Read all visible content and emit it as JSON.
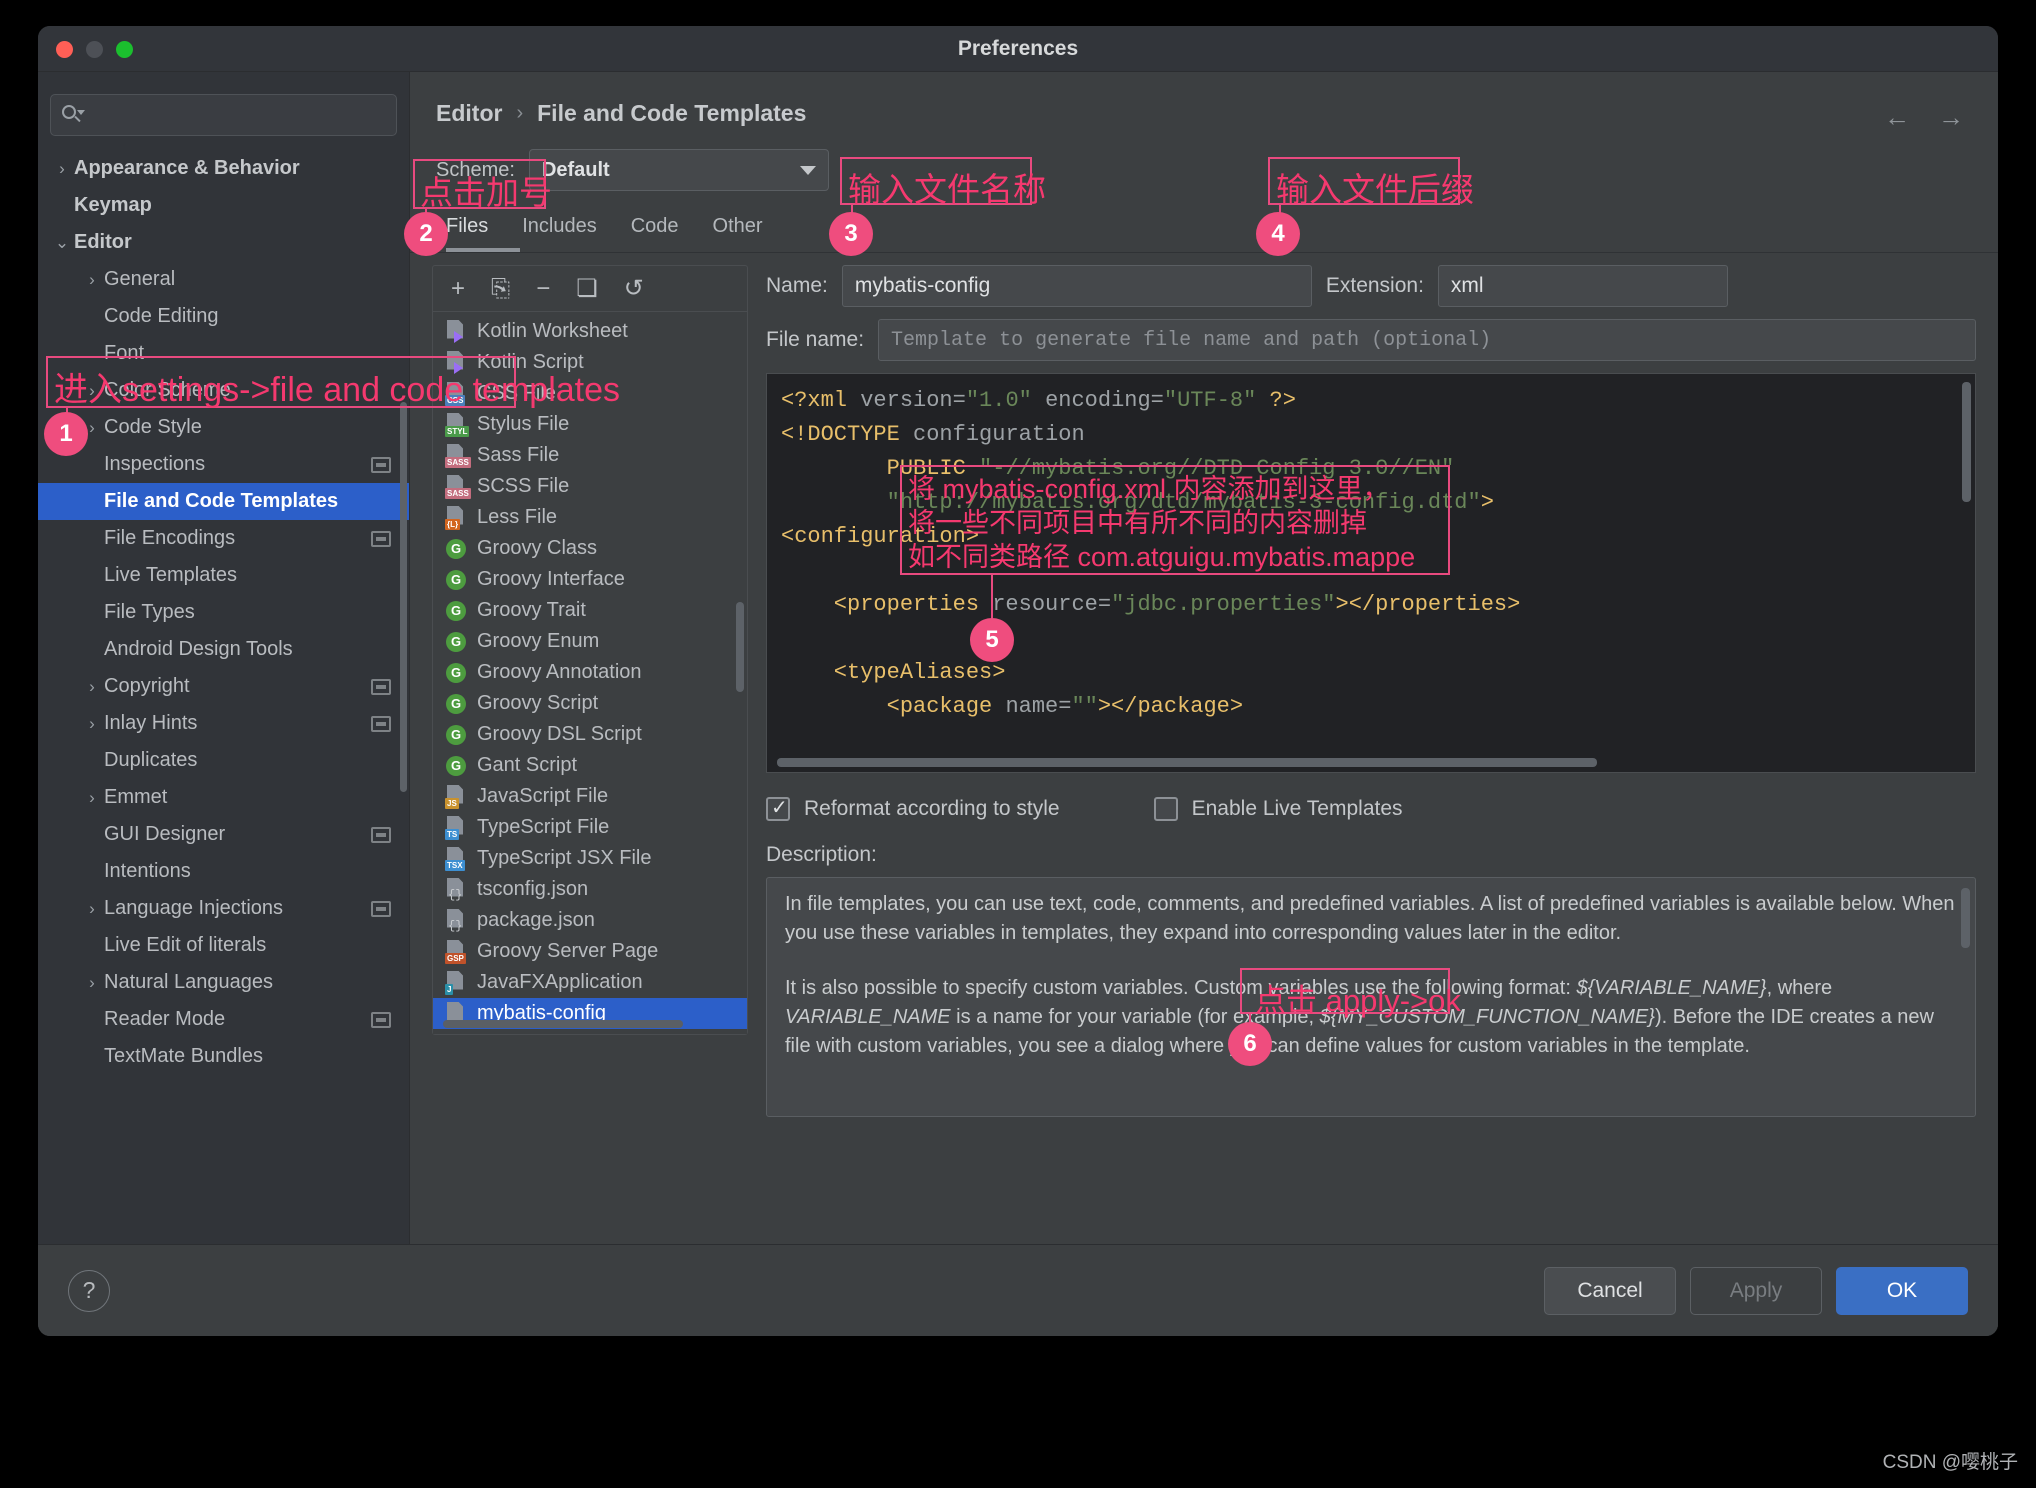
{
  "window": {
    "title": "Preferences"
  },
  "search": {
    "placeholder": ""
  },
  "sidebar": {
    "items": [
      {
        "label": "Appearance & Behavior",
        "chevron": "›",
        "bold": true,
        "indent": 0,
        "badge": false,
        "selected": false
      },
      {
        "label": "Keymap",
        "chevron": "",
        "bold": true,
        "indent": 0,
        "badge": false,
        "selected": false
      },
      {
        "label": "Editor",
        "chevron": "⌄",
        "bold": true,
        "indent": 0,
        "badge": false,
        "selected": false
      },
      {
        "label": "General",
        "chevron": "›",
        "bold": false,
        "indent": 1,
        "badge": false,
        "selected": false
      },
      {
        "label": "Code Editing",
        "chevron": "",
        "bold": false,
        "indent": 1,
        "badge": false,
        "selected": false
      },
      {
        "label": "Font",
        "chevron": "",
        "bold": false,
        "indent": 1,
        "badge": false,
        "selected": false
      },
      {
        "label": "Color Scheme",
        "chevron": "›",
        "bold": false,
        "indent": 1,
        "badge": false,
        "selected": false
      },
      {
        "label": "Code Style",
        "chevron": "›",
        "bold": false,
        "indent": 1,
        "badge": false,
        "selected": false
      },
      {
        "label": "Inspections",
        "chevron": "",
        "bold": false,
        "indent": 1,
        "badge": true,
        "selected": false
      },
      {
        "label": "File and Code Templates",
        "chevron": "",
        "bold": false,
        "indent": 1,
        "badge": false,
        "selected": true
      },
      {
        "label": "File Encodings",
        "chevron": "",
        "bold": false,
        "indent": 1,
        "badge": true,
        "selected": false
      },
      {
        "label": "Live Templates",
        "chevron": "",
        "bold": false,
        "indent": 1,
        "badge": false,
        "selected": false
      },
      {
        "label": "File Types",
        "chevron": "",
        "bold": false,
        "indent": 1,
        "badge": false,
        "selected": false
      },
      {
        "label": "Android Design Tools",
        "chevron": "",
        "bold": false,
        "indent": 1,
        "badge": false,
        "selected": false
      },
      {
        "label": "Copyright",
        "chevron": "›",
        "bold": false,
        "indent": 1,
        "badge": true,
        "selected": false
      },
      {
        "label": "Inlay Hints",
        "chevron": "›",
        "bold": false,
        "indent": 1,
        "badge": true,
        "selected": false
      },
      {
        "label": "Duplicates",
        "chevron": "",
        "bold": false,
        "indent": 1,
        "badge": false,
        "selected": false
      },
      {
        "label": "Emmet",
        "chevron": "›",
        "bold": false,
        "indent": 1,
        "badge": false,
        "selected": false
      },
      {
        "label": "GUI Designer",
        "chevron": "",
        "bold": false,
        "indent": 1,
        "badge": true,
        "selected": false
      },
      {
        "label": "Intentions",
        "chevron": "",
        "bold": false,
        "indent": 1,
        "badge": false,
        "selected": false
      },
      {
        "label": "Language Injections",
        "chevron": "›",
        "bold": false,
        "indent": 1,
        "badge": true,
        "selected": false
      },
      {
        "label": "Live Edit of literals",
        "chevron": "",
        "bold": false,
        "indent": 1,
        "badge": false,
        "selected": false
      },
      {
        "label": "Natural Languages",
        "chevron": "›",
        "bold": false,
        "indent": 1,
        "badge": false,
        "selected": false
      },
      {
        "label": "Reader Mode",
        "chevron": "",
        "bold": false,
        "indent": 1,
        "badge": true,
        "selected": false
      },
      {
        "label": "TextMate Bundles",
        "chevron": "",
        "bold": false,
        "indent": 1,
        "badge": false,
        "selected": false
      }
    ]
  },
  "breadcrumb": {
    "root": "Editor",
    "separator": "›",
    "leaf": "File and Code Templates"
  },
  "nav": {
    "back": "←",
    "forward": "→"
  },
  "scheme": {
    "label": "Scheme:",
    "value": "Default"
  },
  "tabs": [
    {
      "label": "Files",
      "active": true
    },
    {
      "label": "Includes",
      "active": false
    },
    {
      "label": "Code",
      "active": false
    },
    {
      "label": "Other",
      "active": false
    }
  ],
  "list_toolbar": [
    {
      "name": "add-template-button",
      "glyph": "+"
    },
    {
      "name": "copy-template-button",
      "glyph": "⎘"
    },
    {
      "name": "remove-template-button",
      "glyph": "−"
    },
    {
      "name": "duplicate-template-button",
      "glyph": "❏"
    },
    {
      "name": "reset-template-button",
      "glyph": "↺"
    }
  ],
  "templates": [
    {
      "label": "Kotlin Worksheet",
      "icon": "kotlin-file-icon",
      "tag": "",
      "tagcolor": "",
      "kind": "kotlin",
      "selected": false
    },
    {
      "label": "Kotlin Script",
      "icon": "kotlin-file-icon",
      "tag": "",
      "tagcolor": "",
      "kind": "kotlin",
      "selected": false
    },
    {
      "label": "CSS File",
      "icon": "css-file-icon",
      "tag": "CSS",
      "tagcolor": "#4a7ebb",
      "kind": "tag",
      "selected": false
    },
    {
      "label": "Stylus File",
      "icon": "stylus-file-icon",
      "tag": "STYL",
      "tagcolor": "#4a9b4a",
      "kind": "tag",
      "selected": false
    },
    {
      "label": "Sass File",
      "icon": "sass-file-icon",
      "tag": "SASS",
      "tagcolor": "#c36d7e",
      "kind": "tag",
      "selected": false
    },
    {
      "label": "SCSS File",
      "icon": "scss-file-icon",
      "tag": "SASS",
      "tagcolor": "#c36d7e",
      "kind": "tag",
      "selected": false
    },
    {
      "label": "Less File",
      "icon": "less-file-icon",
      "tag": "{L}",
      "tagcolor": "#d2651f",
      "kind": "tag",
      "selected": false
    },
    {
      "label": "Groovy Class",
      "icon": "groovy-class-icon",
      "tag": "G",
      "tagcolor": "#4d9c3f",
      "kind": "circle",
      "selected": false
    },
    {
      "label": "Groovy Interface",
      "icon": "groovy-interface-icon",
      "tag": "G",
      "tagcolor": "#4d9c3f",
      "kind": "circle",
      "selected": false
    },
    {
      "label": "Groovy Trait",
      "icon": "groovy-trait-icon",
      "tag": "G",
      "tagcolor": "#4d9c3f",
      "kind": "circle",
      "selected": false
    },
    {
      "label": "Groovy Enum",
      "icon": "groovy-enum-icon",
      "tag": "G",
      "tagcolor": "#4d9c3f",
      "kind": "circle",
      "selected": false
    },
    {
      "label": "Groovy Annotation",
      "icon": "groovy-annotation-icon",
      "tag": "G",
      "tagcolor": "#4d9c3f",
      "kind": "circle",
      "selected": false
    },
    {
      "label": "Groovy Script",
      "icon": "groovy-script-icon",
      "tag": "G",
      "tagcolor": "#4d9c3f",
      "kind": "circle",
      "selected": false
    },
    {
      "label": "Groovy DSL Script",
      "icon": "groovy-dsl-script-icon",
      "tag": "G",
      "tagcolor": "#4d9c3f",
      "kind": "circle",
      "selected": false
    },
    {
      "label": "Gant Script",
      "icon": "gant-script-icon",
      "tag": "G",
      "tagcolor": "#4d9c3f",
      "kind": "circle",
      "selected": false
    },
    {
      "label": "JavaScript File",
      "icon": "javascript-file-icon",
      "tag": "JS",
      "tagcolor": "#c9922e",
      "kind": "tag",
      "selected": false
    },
    {
      "label": "TypeScript File",
      "icon": "typescript-file-icon",
      "tag": "TS",
      "tagcolor": "#3d8fd1",
      "kind": "tag",
      "selected": false
    },
    {
      "label": "TypeScript JSX File",
      "icon": "typescript-jsx-file-icon",
      "tag": "TSX",
      "tagcolor": "#3d8fd1",
      "kind": "tag",
      "selected": false
    },
    {
      "label": "tsconfig.json",
      "icon": "json-file-icon",
      "tag": "{}",
      "tagcolor": "",
      "kind": "json",
      "selected": false
    },
    {
      "label": "package.json",
      "icon": "json-file-icon",
      "tag": "{}",
      "tagcolor": "",
      "kind": "json",
      "selected": false
    },
    {
      "label": "Groovy Server Page",
      "icon": "gsp-file-icon",
      "tag": "GSP",
      "tagcolor": "#c0522a",
      "kind": "tag",
      "selected": false
    },
    {
      "label": "JavaFXApplication",
      "icon": "java-file-icon",
      "tag": "J",
      "tagcolor": "#2a8fa8",
      "kind": "tag",
      "selected": false
    },
    {
      "label": "mybatis-config",
      "icon": "xml-file-icon",
      "tag": "",
      "tagcolor": "",
      "kind": "plain",
      "selected": true
    }
  ],
  "fields": {
    "name_label": "Name:",
    "name_value": "mybatis-config",
    "extension_label": "Extension:",
    "extension_value": "xml",
    "filename_label": "File name:",
    "filename_placeholder": "Template to generate file name and path (optional)"
  },
  "code": {
    "lines": [
      [
        {
          "t": "<?xml ",
          "c": "k-tag"
        },
        {
          "t": "version=",
          "c": "k-attr"
        },
        {
          "t": "\"1.0\" ",
          "c": "k-str"
        },
        {
          "t": "encoding=",
          "c": "k-attr"
        },
        {
          "t": "\"UTF-8\" ",
          "c": "k-str"
        },
        {
          "t": "?>",
          "c": "k-tag"
        }
      ],
      [
        {
          "t": "<!DOCTYPE ",
          "c": "k-tag"
        },
        {
          "t": "configuration",
          "c": "k-attr"
        }
      ],
      [
        {
          "t": "        PUBLIC ",
          "c": "k-tag"
        },
        {
          "t": "\"-//mybatis.org//DTD Config 3.0//EN\"",
          "c": "k-str"
        }
      ],
      [
        {
          "t": "        \"http://mybatis.org/dtd/mybatis-3-config.dtd\"",
          "c": "k-str"
        },
        {
          "t": ">",
          "c": "k-tag"
        }
      ],
      [
        {
          "t": "<configuration>",
          "c": "k-tag"
        }
      ],
      [
        {
          "t": "",
          "c": "k-tag"
        }
      ],
      [
        {
          "t": "    <properties ",
          "c": "k-tag"
        },
        {
          "t": "resource=",
          "c": "k-attr"
        },
        {
          "t": "\"jdbc.properties\"",
          "c": "k-str"
        },
        {
          "t": "></properties>",
          "c": "k-tag"
        }
      ],
      [
        {
          "t": "",
          "c": "k-tag"
        }
      ],
      [
        {
          "t": "    <typeAliases>",
          "c": "k-tag"
        }
      ],
      [
        {
          "t": "        <package ",
          "c": "k-tag"
        },
        {
          "t": "name=",
          "c": "k-attr"
        },
        {
          "t": "\"\"",
          "c": "k-str"
        },
        {
          "t": "></package>",
          "c": "k-tag"
        }
      ]
    ]
  },
  "checkboxes": {
    "reformat_label": "Reformat according to style",
    "reformat_checked": true,
    "live_templates_label": "Enable Live Templates",
    "live_templates_checked": false
  },
  "description": {
    "label": "Description:",
    "p1": "In file templates, you can use text, code, comments, and predefined variables. A list of predefined variables is available below. When you use these variables in templates, they expand into corresponding values later in the editor.",
    "p2_a": "It is also possible to specify custom variables. Custom variables use the following format: ",
    "p2_v1": "${VARIABLE_NAME}",
    "p2_b": ", where ",
    "p2_v2": "VARIABLE_NAME",
    "p2_c": " is a name for your variable (for example, ",
    "p2_v3": "${MY_CUSTOM_FUNCTION_NAME}",
    "p2_d": "). Before the IDE creates a new file with custom variables, you see a dialog where you can define values for custom variables in the template."
  },
  "footer": {
    "help": "?",
    "cancel": "Cancel",
    "apply": "Apply",
    "ok": "OK"
  },
  "annotations": {
    "a1_text": "进入settings->file and code templates",
    "a1_num": "1",
    "a2_text": "点击加号",
    "a2_num": "2",
    "a3_text": "输入文件名称",
    "a3_num": "3",
    "a4_text": "输入文件后缀",
    "a4_num": "4",
    "a5_line1": "将 mybatis-config.xml 内容添加到这里，",
    "a5_line2": "将一些不同项目中有所不同的内容删掉",
    "a5_line3": "如不同类路径 com.atguigu.mybatis.mappe",
    "a5_num": "5",
    "a6_text": "点击 apply->ok",
    "a6_num": "6",
    "color": "#f5396f"
  },
  "watermark": "CSDN @嘤桃子"
}
